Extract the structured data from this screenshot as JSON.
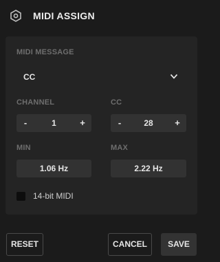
{
  "header": {
    "title": "MIDI ASSIGN",
    "icon": "hexagon-settings-icon"
  },
  "midi_message": {
    "label": "MIDI MESSAGE",
    "selected": "CC"
  },
  "channel": {
    "label": "CHANNEL",
    "value": "1",
    "minus": "-",
    "plus": "+"
  },
  "cc": {
    "label": "CC",
    "value": "28",
    "minus": "-",
    "plus": "+"
  },
  "min": {
    "label": "MIN",
    "value": "1.06 Hz"
  },
  "max": {
    "label": "MAX",
    "value": "2.22 Hz"
  },
  "fourteen_bit": {
    "label": "14-bit MIDI",
    "checked": false
  },
  "footer": {
    "reset": "RESET",
    "cancel": "CANCEL",
    "save": "SAVE"
  }
}
